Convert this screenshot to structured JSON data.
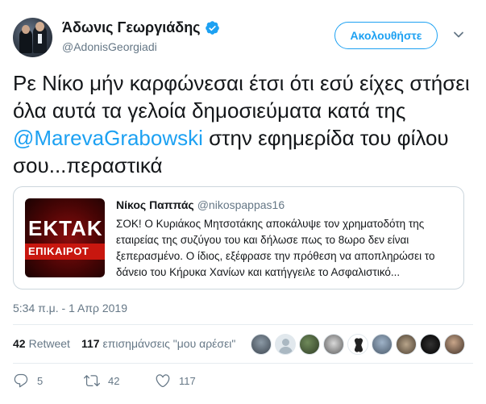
{
  "author": {
    "display_name": "Άδωνις Γεωργιάδης",
    "handle": "@AdonisGeorgiadi",
    "verified": true,
    "follow_label": "Ακολουθήστε"
  },
  "tweet": {
    "text_before": "Ρε Νίκο μήν καρφώνεσαι έτσι ότι εσύ είχες στήσει όλα αυτά τα γελοία δημοσιεύματα κατά της ",
    "mention": "@MarevaGrabowski",
    "text_after": " στην εφημερίδα του φίλου σου...περαστικά"
  },
  "quoted": {
    "name": "Νίκος Παππάς",
    "handle": "@nikospappas16",
    "text": "ΣΟΚ! Ο Κυριάκος Μητσοτάκης αποκάλυψε τον χρηματοδότη της εταιρείας της συζύγου του και δήλωσε πως το 8ωρο δεν είναι ξεπερασμένο. Ο ίδιος, εξέφρασε την πρόθεση να αποπληρώσει το δάνειο του Κήρυκα Χανίων και κατήγγειλε το Ασφαλιστικό...",
    "thumb_line1": "ΕΚΤΑΚ",
    "thumb_line2": "ΕΠΙΚΑΙΡΟΤ"
  },
  "timestamp": "5:34 π.μ. - 1 Απρ 2019",
  "stats": {
    "retweets": "42",
    "retweets_label": "Retweet",
    "likes": "117",
    "likes_label": "επισημάνσεις \"μου αρέσει\""
  },
  "actions": {
    "replies": "5",
    "retweets": "42",
    "likes": "117"
  },
  "colors": {
    "accent": "#1da1f2",
    "muted": "#657786",
    "text": "#14171a"
  },
  "icons": [
    "verified-badge-icon",
    "chevron-down-icon",
    "reply-icon",
    "retweet-icon",
    "like-icon"
  ]
}
